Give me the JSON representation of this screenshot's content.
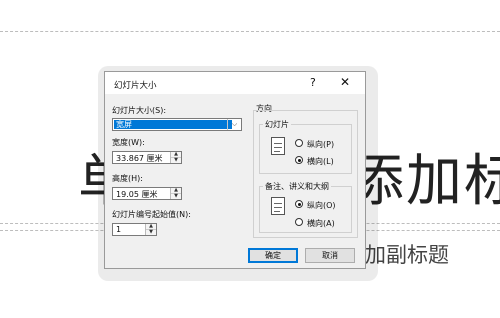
{
  "slide": {
    "title_left": "单",
    "title_right": "添加标",
    "subtitle": "加副标题"
  },
  "dialog": {
    "title": "幻灯片大小",
    "help": "?",
    "close": "✕",
    "slide_size_label": "幻灯片大小(S):",
    "slide_size_value": "宽屏",
    "width_label": "宽度(W):",
    "width_value": "33.867 厘米",
    "height_label": "高度(H):",
    "height_value": "19.05 厘米",
    "number_from_label": "幻灯片编号起始值(N):",
    "number_from_value": "1",
    "orientation_label": "方向",
    "slides_group_label": "幻灯片",
    "slides_portrait": "纵向(P)",
    "slides_landscape": "横向(L)",
    "notes_group_label": "备注、讲义和大纲",
    "notes_portrait": "纵向(O)",
    "notes_landscape": "横向(A)",
    "ok": "确定",
    "cancel": "取消",
    "selected": {
      "slides": "landscape",
      "notes": "portrait"
    }
  },
  "icons": {
    "dropdown": "chevron-down-icon",
    "spin_up": "up-arrow-icon",
    "spin_down": "down-arrow-icon"
  },
  "colors": {
    "accent": "#0078d7",
    "dialog_bg": "#f0f0f0"
  }
}
